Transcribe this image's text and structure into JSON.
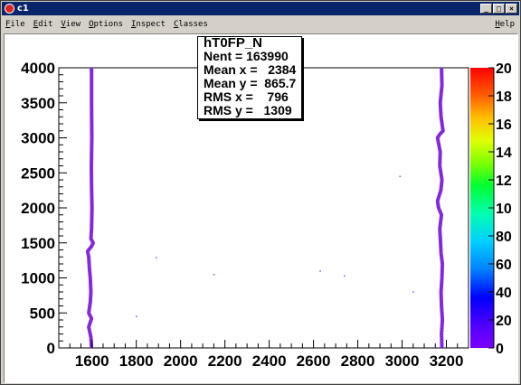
{
  "window": {
    "title": "c1",
    "minimize_glyph": "_",
    "maximize_glyph": "□",
    "close_glyph": "×"
  },
  "menu": {
    "items": [
      {
        "first": "F",
        "rest": "ile"
      },
      {
        "first": "E",
        "rest": "dit"
      },
      {
        "first": "V",
        "rest": "iew"
      },
      {
        "first": "O",
        "rest": "ptions"
      },
      {
        "first": "I",
        "rest": "nspect"
      },
      {
        "first": "C",
        "rest": "lasses"
      }
    ],
    "help": {
      "first": "H",
      "rest": "elp"
    }
  },
  "stats": {
    "title": "hT0FP_N",
    "lines": [
      "Nent = 163990",
      "Mean x =   2384",
      "Mean y =  865.7",
      "RMS x =    796",
      "RMS y =   1309"
    ]
  },
  "chart_data": {
    "type": "heatmap",
    "title": "",
    "xlabel": "",
    "ylabel": "",
    "xlim": [
      1450,
      3300
    ],
    "ylim": [
      0,
      4000
    ],
    "x_ticks": [
      "1600",
      "1800",
      "2000",
      "2200",
      "2400",
      "2600",
      "2800",
      "3000",
      "3200"
    ],
    "x_tick_values": [
      1600,
      1800,
      2000,
      2200,
      2400,
      2600,
      2800,
      3000,
      3200
    ],
    "y_ticks": [
      "0",
      "500",
      "1000",
      "1500",
      "2000",
      "2500",
      "3000",
      "3500",
      "4000"
    ],
    "y_tick_values": [
      0,
      500,
      1000,
      1500,
      2000,
      2500,
      3000,
      3500,
      4000
    ],
    "palette_ticks": [
      "0",
      "20",
      "40",
      "60",
      "80",
      "10",
      "12",
      "14",
      "16",
      "18",
      "20"
    ],
    "palette_range": [
      0,
      200
    ],
    "band_color": "#8a2be2",
    "background": "#ffffff",
    "bands": [
      {
        "name": "",
        "points": [
          [
            1598,
            0
          ],
          [
            1595,
            150
          ],
          [
            1585,
            300
          ],
          [
            1598,
            420
          ],
          [
            1585,
            500
          ],
          [
            1592,
            650
          ],
          [
            1595,
            800
          ],
          [
            1592,
            1000
          ],
          [
            1588,
            1150
          ],
          [
            1585,
            1300
          ],
          [
            1580,
            1380
          ],
          [
            1598,
            1450
          ],
          [
            1605,
            1500
          ],
          [
            1595,
            1560
          ],
          [
            1598,
            1700
          ],
          [
            1600,
            2000
          ],
          [
            1598,
            2300
          ],
          [
            1597,
            2600
          ],
          [
            1599,
            3000
          ],
          [
            1598,
            3500
          ],
          [
            1598,
            4000
          ]
        ]
      },
      {
        "name": "",
        "points": [
          [
            3180,
            0
          ],
          [
            3178,
            200
          ],
          [
            3182,
            400
          ],
          [
            3178,
            600
          ],
          [
            3176,
            800
          ],
          [
            3180,
            1000
          ],
          [
            3182,
            1200
          ],
          [
            3176,
            1350
          ],
          [
            3174,
            1500
          ],
          [
            3170,
            1700
          ],
          [
            3178,
            1900
          ],
          [
            3165,
            2000
          ],
          [
            3160,
            2100
          ],
          [
            3175,
            2250
          ],
          [
            3180,
            2400
          ],
          [
            3170,
            2600
          ],
          [
            3172,
            2800
          ],
          [
            3160,
            3000
          ],
          [
            3170,
            3050
          ],
          [
            3185,
            3100
          ],
          [
            3176,
            3300
          ],
          [
            3172,
            3500
          ],
          [
            3180,
            3750
          ],
          [
            3178,
            4000
          ]
        ]
      }
    ],
    "scattered_points": [
      [
        1890,
        1290
      ],
      [
        1800,
        450
      ],
      [
        2150,
        1050
      ],
      [
        2630,
        1100
      ],
      [
        2740,
        1030
      ],
      [
        2990,
        2450
      ],
      [
        3050,
        800
      ]
    ]
  }
}
